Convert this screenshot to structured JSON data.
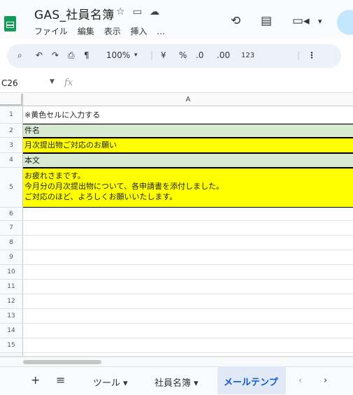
{
  "header": {
    "title": "GAS_社員名簿",
    "menu": [
      "ファイル",
      "編集",
      "表示",
      "挿入",
      "..."
    ]
  },
  "toolbar": {
    "zoom": "100%",
    "currency": "¥",
    "percent": "%",
    "decrease_decimal": ".0",
    "increase_decimal": ".00",
    "number_format": "123"
  },
  "formula_bar": {
    "cell_ref": "C26",
    "fx": "fx"
  },
  "grid": {
    "column_header": "A",
    "rows": [
      {
        "num": "1",
        "text": "※黄色セルに入力する"
      },
      {
        "num": "2",
        "text": "件名"
      },
      {
        "num": "3",
        "text": "月次提出物ご対応のお願い"
      },
      {
        "num": "4",
        "text": "本文"
      },
      {
        "num": "5",
        "text": "お疲れさまです。\n今月分の月次提出物について、各申請書を添付しました。\nご対応のほど、よろしくお願いいたします。"
      },
      {
        "num": "6",
        "text": ""
      },
      {
        "num": "7",
        "text": ""
      },
      {
        "num": "8",
        "text": ""
      },
      {
        "num": "9",
        "text": ""
      },
      {
        "num": "10",
        "text": ""
      },
      {
        "num": "11",
        "text": ""
      },
      {
        "num": "12",
        "text": ""
      },
      {
        "num": "13",
        "text": ""
      },
      {
        "num": "14",
        "text": ""
      },
      {
        "num": "15",
        "text": ""
      }
    ]
  },
  "tabs": {
    "add": "+",
    "all_sheets": "≡",
    "items": [
      "ツール ▾",
      "社員名簿 ▾",
      "メールテンプ"
    ],
    "prev": "‹",
    "next": "›"
  },
  "colors": {
    "yellow_cell": "#ffff00",
    "green_cell": "#d9ead3",
    "active_tab": "#0b57d0"
  }
}
